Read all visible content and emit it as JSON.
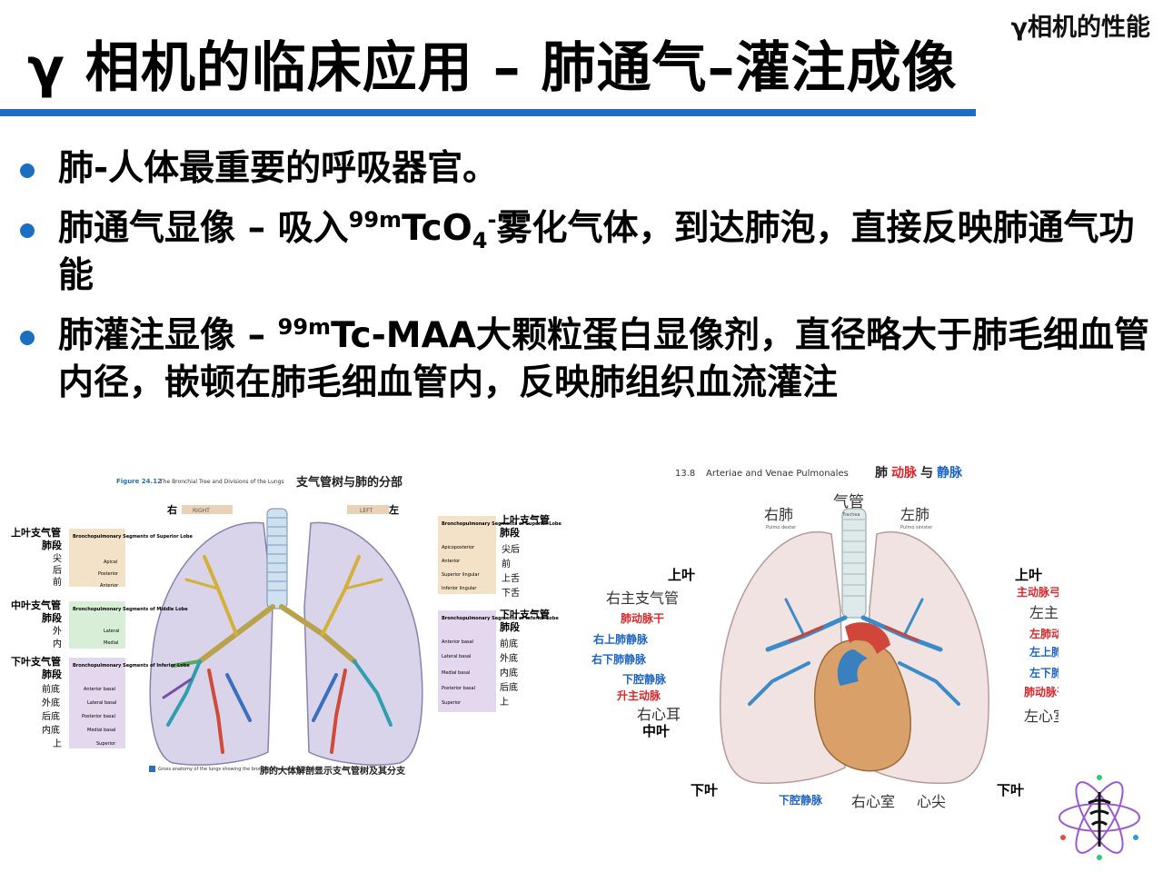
{
  "header": {
    "corner_label": "γ相机的性能",
    "title": "γ 相机的临床应用  –  肺通气–灌注成像"
  },
  "bullets": [
    {
      "text": "肺-人体最重要的呼吸器官。"
    },
    {
      "pre": "肺通气显像 – 吸入",
      "sup": "99m",
      "mid": "TcO",
      "sub": "4",
      "sup2": "-",
      "post": "雾化气体，到达肺泡，直接反映肺通气功能"
    },
    {
      "pre": "肺灌注显像 – ",
      "sup": "99m",
      "post": "Tc-MAA大颗粒蛋白显像剂，直径略大于肺毛细血管内径，嵌顿在肺毛细血管内，反映肺组织血流灌注"
    }
  ],
  "left_figure": {
    "caption_prefix": "Figure 24.12",
    "caption_en": "The Bronchial Tree and Divisions of the Lungs",
    "caption_cn": "支气管树与肺的分部",
    "right_label": "RIGHT",
    "left_label": "LEFT",
    "right_cn": "右",
    "left_cn": "左",
    "upper_left_label": "上叶支气管",
    "upper_left_sub": "肺段",
    "upper_left_items": [
      "尖",
      "后",
      "前"
    ],
    "middle_left_label": "中叶支气管",
    "middle_left_sub": "肺段",
    "middle_left_items": [
      "外",
      "内"
    ],
    "lower_left_label": "下叶支气管",
    "lower_left_sub": "肺段",
    "lower_left_items": [
      "前底",
      "外底",
      "后底",
      "内底",
      "上"
    ],
    "upper_right_label": "上叶支气管",
    "upper_right_sub": "肺段",
    "upper_right_items": [
      "尖后",
      "前",
      "上舌",
      "下舌"
    ],
    "lower_right_label": "下叶支气管",
    "lower_right_sub": "肺段",
    "lower_right_items": [
      "前底",
      "外底",
      "内底",
      "后底",
      "上"
    ],
    "upper_box_en": "Bronchopulmonary Segments of Superior Lobe",
    "upper_box_items": [
      "Apical",
      "Posterior",
      "Anterior"
    ],
    "middle_box_en": "Bronchopulmonary Segments of Middle Lobe",
    "middle_box_items": [
      "Lateral",
      "Medial"
    ],
    "lower_box_en": "Bronchopulmonary Segments of Inferior Lobe",
    "lower_box_items": [
      "Anterior basal",
      "Lateral basal",
      "Posterior basal",
      "Medial basal",
      "Superior"
    ],
    "right_upper_box_en": "Bronchopulmonary Segments of Superior Lobe",
    "right_upper_box_items": [
      "Apicoposterior",
      "Anterior",
      "Superior lingular",
      "Inferior lingular"
    ],
    "right_lower_box_en": "Bronchopulmonary Segments of Inferior Lobe",
    "right_lower_box_items": [
      "Anterior basal",
      "Lateral basal",
      "Medial basal",
      "Posterior basal",
      "Superior"
    ],
    "bottom_note_en": "Gross anatomy of the lungs showing the bronchial tree and its divisions.",
    "bottom_note_cn": "肺的大体解剖显示支气管树及其分支"
  },
  "right_figure": {
    "caption_num": "13.8",
    "caption_en": "Arteriae and Venae Pulmonales",
    "caption_cn_a": "肺",
    "caption_cn_b": "动脉",
    "caption_cn_c": "与",
    "caption_cn_d": "静脉",
    "trachea_cn": "气管",
    "trachea_en": "Trachea",
    "right_lung_cn": "右肺",
    "right_lung_en": "Pulmo dexter",
    "left_lung_cn": "左肺",
    "left_lung_en": "Pulmo sinister",
    "upper_lobe_r": "上叶",
    "upper_lobe_l": "上叶",
    "middle_lobe": "中叶",
    "lower_lobe_r": "下叶",
    "lower_lobe_l": "下叶",
    "labels_left": [
      "右主支气管",
      "肺动脉干",
      "右上肺静脉",
      "右下肺静脉",
      "下腔静脉",
      "升主动脉",
      "右心耳"
    ],
    "labels_right": [
      "主动脉弓",
      "左主支气管",
      "左肺动脉",
      "左上肺静脉",
      "左下肺静脉",
      "肺动脉干",
      "左心室"
    ],
    "labels_bottom": [
      "下腔静脉",
      "右心室",
      "心尖"
    ]
  },
  "colors": {
    "accent": "#1a6fc2",
    "label_red": "#d8262a",
    "label_blue": "#1c63c2"
  }
}
